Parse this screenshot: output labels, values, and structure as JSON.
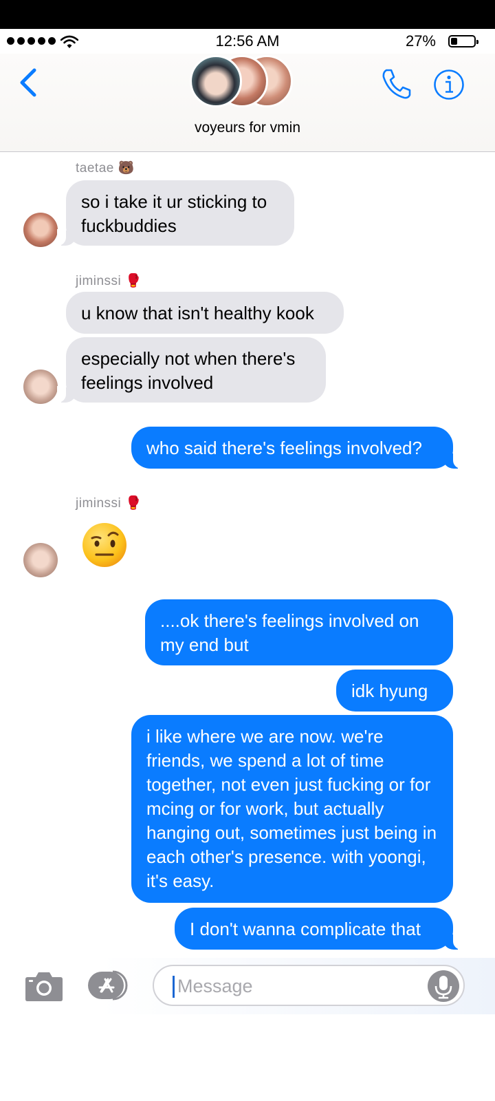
{
  "status_bar": {
    "time": "12:56 AM",
    "battery": "27%",
    "battery_level": 0.27,
    "signal_bars": 5
  },
  "header": {
    "group_name": "voyeurs for vmin"
  },
  "messages": [
    {
      "sender": "taetae 🐻",
      "text": "so i take it ur sticking to fuckbuddies"
    },
    {
      "sender": "jiminssi 🥊",
      "text": "u know that isn't healthy kook"
    },
    {
      "text": "especially not when there's feelings involved"
    },
    {
      "text": "who said there's feelings involved?"
    },
    {
      "sender": "jiminssi 🥊",
      "text": "🤨"
    },
    {
      "text": "....ok there's feelings involved on my end but"
    },
    {
      "text": "idk hyung"
    },
    {
      "text": "i like where we are now. we're friends, we spend a lot of time together, not even just fucking or for mcing or for work, but actually hanging out, sometimes just being in each other's presence. with yoongi, it's easy."
    },
    {
      "text": "I don't wanna complicate that"
    }
  ],
  "composer": {
    "placeholder": "Message"
  },
  "colors": {
    "outgoing": "#0a7cff",
    "incoming": "#e5e5ea",
    "accent": "#0a7cff"
  }
}
